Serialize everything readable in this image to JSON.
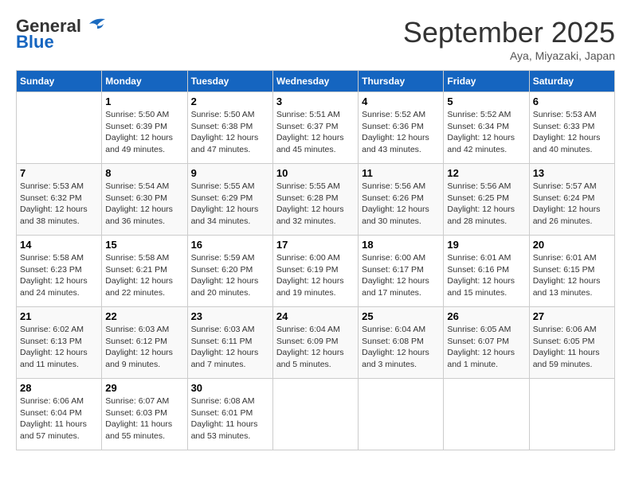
{
  "header": {
    "logo_line1": "General",
    "logo_line2": "Blue",
    "month": "September 2025",
    "location": "Aya, Miyazaki, Japan"
  },
  "weekdays": [
    "Sunday",
    "Monday",
    "Tuesday",
    "Wednesday",
    "Thursday",
    "Friday",
    "Saturday"
  ],
  "weeks": [
    [
      {
        "day": "",
        "sunrise": "",
        "sunset": "",
        "daylight": ""
      },
      {
        "day": "1",
        "sunrise": "Sunrise: 5:50 AM",
        "sunset": "Sunset: 6:39 PM",
        "daylight": "Daylight: 12 hours and 49 minutes."
      },
      {
        "day": "2",
        "sunrise": "Sunrise: 5:50 AM",
        "sunset": "Sunset: 6:38 PM",
        "daylight": "Daylight: 12 hours and 47 minutes."
      },
      {
        "day": "3",
        "sunrise": "Sunrise: 5:51 AM",
        "sunset": "Sunset: 6:37 PM",
        "daylight": "Daylight: 12 hours and 45 minutes."
      },
      {
        "day": "4",
        "sunrise": "Sunrise: 5:52 AM",
        "sunset": "Sunset: 6:36 PM",
        "daylight": "Daylight: 12 hours and 43 minutes."
      },
      {
        "day": "5",
        "sunrise": "Sunrise: 5:52 AM",
        "sunset": "Sunset: 6:34 PM",
        "daylight": "Daylight: 12 hours and 42 minutes."
      },
      {
        "day": "6",
        "sunrise": "Sunrise: 5:53 AM",
        "sunset": "Sunset: 6:33 PM",
        "daylight": "Daylight: 12 hours and 40 minutes."
      }
    ],
    [
      {
        "day": "7",
        "sunrise": "Sunrise: 5:53 AM",
        "sunset": "Sunset: 6:32 PM",
        "daylight": "Daylight: 12 hours and 38 minutes."
      },
      {
        "day": "8",
        "sunrise": "Sunrise: 5:54 AM",
        "sunset": "Sunset: 6:30 PM",
        "daylight": "Daylight: 12 hours and 36 minutes."
      },
      {
        "day": "9",
        "sunrise": "Sunrise: 5:55 AM",
        "sunset": "Sunset: 6:29 PM",
        "daylight": "Daylight: 12 hours and 34 minutes."
      },
      {
        "day": "10",
        "sunrise": "Sunrise: 5:55 AM",
        "sunset": "Sunset: 6:28 PM",
        "daylight": "Daylight: 12 hours and 32 minutes."
      },
      {
        "day": "11",
        "sunrise": "Sunrise: 5:56 AM",
        "sunset": "Sunset: 6:26 PM",
        "daylight": "Daylight: 12 hours and 30 minutes."
      },
      {
        "day": "12",
        "sunrise": "Sunrise: 5:56 AM",
        "sunset": "Sunset: 6:25 PM",
        "daylight": "Daylight: 12 hours and 28 minutes."
      },
      {
        "day": "13",
        "sunrise": "Sunrise: 5:57 AM",
        "sunset": "Sunset: 6:24 PM",
        "daylight": "Daylight: 12 hours and 26 minutes."
      }
    ],
    [
      {
        "day": "14",
        "sunrise": "Sunrise: 5:58 AM",
        "sunset": "Sunset: 6:23 PM",
        "daylight": "Daylight: 12 hours and 24 minutes."
      },
      {
        "day": "15",
        "sunrise": "Sunrise: 5:58 AM",
        "sunset": "Sunset: 6:21 PM",
        "daylight": "Daylight: 12 hours and 22 minutes."
      },
      {
        "day": "16",
        "sunrise": "Sunrise: 5:59 AM",
        "sunset": "Sunset: 6:20 PM",
        "daylight": "Daylight: 12 hours and 20 minutes."
      },
      {
        "day": "17",
        "sunrise": "Sunrise: 6:00 AM",
        "sunset": "Sunset: 6:19 PM",
        "daylight": "Daylight: 12 hours and 19 minutes."
      },
      {
        "day": "18",
        "sunrise": "Sunrise: 6:00 AM",
        "sunset": "Sunset: 6:17 PM",
        "daylight": "Daylight: 12 hours and 17 minutes."
      },
      {
        "day": "19",
        "sunrise": "Sunrise: 6:01 AM",
        "sunset": "Sunset: 6:16 PM",
        "daylight": "Daylight: 12 hours and 15 minutes."
      },
      {
        "day": "20",
        "sunrise": "Sunrise: 6:01 AM",
        "sunset": "Sunset: 6:15 PM",
        "daylight": "Daylight: 12 hours and 13 minutes."
      }
    ],
    [
      {
        "day": "21",
        "sunrise": "Sunrise: 6:02 AM",
        "sunset": "Sunset: 6:13 PM",
        "daylight": "Daylight: 12 hours and 11 minutes."
      },
      {
        "day": "22",
        "sunrise": "Sunrise: 6:03 AM",
        "sunset": "Sunset: 6:12 PM",
        "daylight": "Daylight: 12 hours and 9 minutes."
      },
      {
        "day": "23",
        "sunrise": "Sunrise: 6:03 AM",
        "sunset": "Sunset: 6:11 PM",
        "daylight": "Daylight: 12 hours and 7 minutes."
      },
      {
        "day": "24",
        "sunrise": "Sunrise: 6:04 AM",
        "sunset": "Sunset: 6:09 PM",
        "daylight": "Daylight: 12 hours and 5 minutes."
      },
      {
        "day": "25",
        "sunrise": "Sunrise: 6:04 AM",
        "sunset": "Sunset: 6:08 PM",
        "daylight": "Daylight: 12 hours and 3 minutes."
      },
      {
        "day": "26",
        "sunrise": "Sunrise: 6:05 AM",
        "sunset": "Sunset: 6:07 PM",
        "daylight": "Daylight: 12 hours and 1 minute."
      },
      {
        "day": "27",
        "sunrise": "Sunrise: 6:06 AM",
        "sunset": "Sunset: 6:05 PM",
        "daylight": "Daylight: 11 hours and 59 minutes."
      }
    ],
    [
      {
        "day": "28",
        "sunrise": "Sunrise: 6:06 AM",
        "sunset": "Sunset: 6:04 PM",
        "daylight": "Daylight: 11 hours and 57 minutes."
      },
      {
        "day": "29",
        "sunrise": "Sunrise: 6:07 AM",
        "sunset": "Sunset: 6:03 PM",
        "daylight": "Daylight: 11 hours and 55 minutes."
      },
      {
        "day": "30",
        "sunrise": "Sunrise: 6:08 AM",
        "sunset": "Sunset: 6:01 PM",
        "daylight": "Daylight: 11 hours and 53 minutes."
      },
      {
        "day": "",
        "sunrise": "",
        "sunset": "",
        "daylight": ""
      },
      {
        "day": "",
        "sunrise": "",
        "sunset": "",
        "daylight": ""
      },
      {
        "day": "",
        "sunrise": "",
        "sunset": "",
        "daylight": ""
      },
      {
        "day": "",
        "sunrise": "",
        "sunset": "",
        "daylight": ""
      }
    ]
  ]
}
